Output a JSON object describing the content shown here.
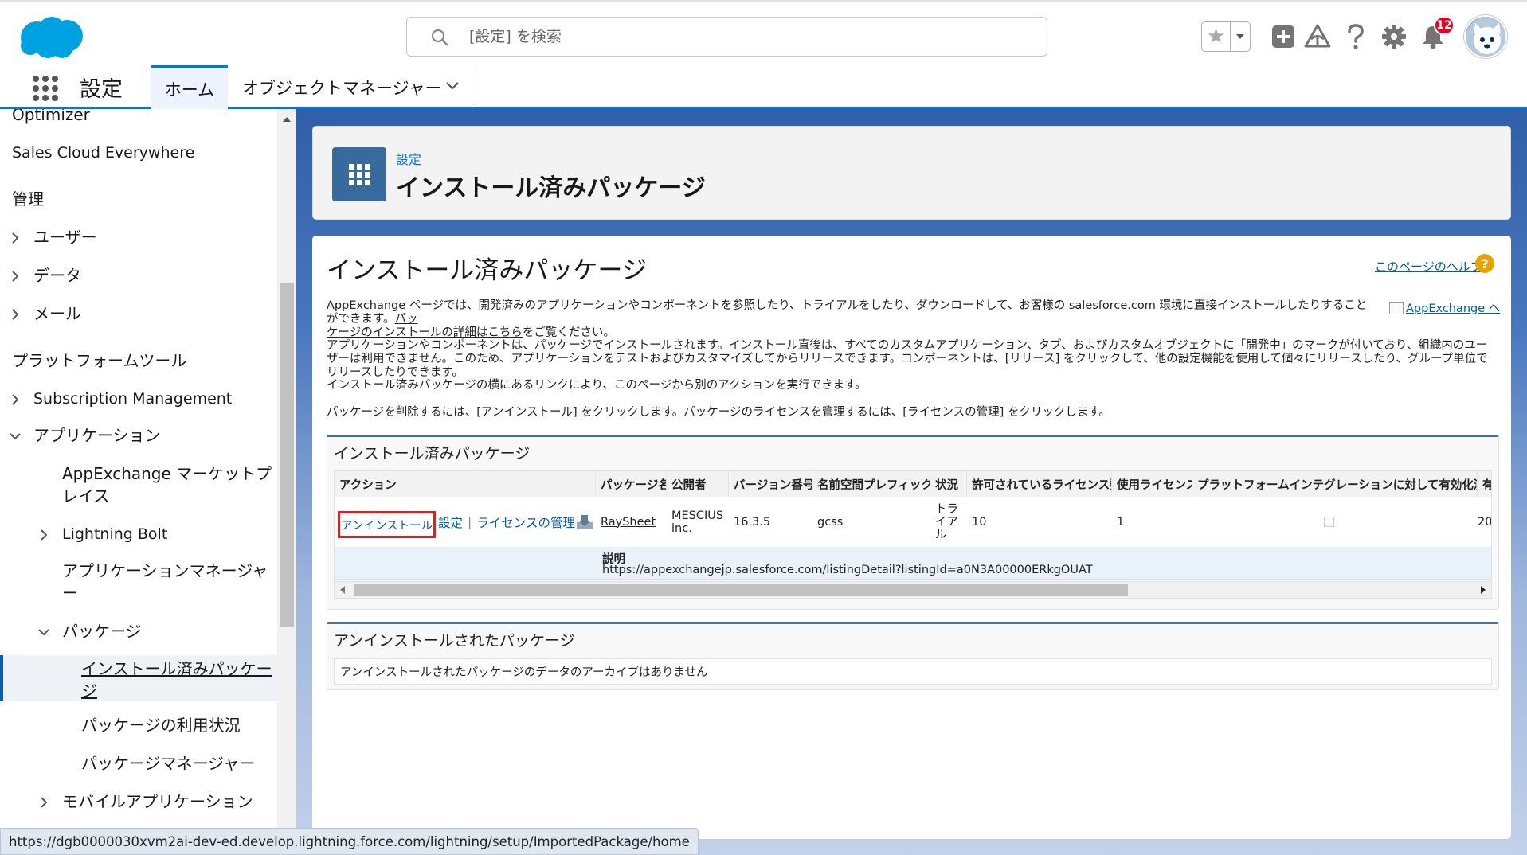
{
  "header": {
    "search_placeholder": "[設定] を検索",
    "notifications_count": "12",
    "accent_color": "#0176d3",
    "icons": [
      "salesforce-cloud-icon",
      "search-icon",
      "star-icon",
      "add-icon",
      "trailhead-icon",
      "help-icon",
      "gear-icon",
      "bell-icon",
      "avatar"
    ]
  },
  "context": {
    "app_name": "設定",
    "tabs": [
      {
        "label": "ホーム",
        "active": true
      },
      {
        "label": "オブジェクトマネージャー",
        "active": false
      }
    ]
  },
  "sidebar": {
    "items": [
      {
        "label": "Optimizer"
      },
      {
        "label": "Sales Cloud Everywhere"
      },
      {
        "label": "管理"
      },
      {
        "label": "ユーザー",
        "expandable": true
      },
      {
        "label": "データ",
        "expandable": true
      },
      {
        "label": "メール",
        "expandable": true
      },
      {
        "label": "プラットフォームツール"
      },
      {
        "label": "Subscription Management",
        "expandable": true
      },
      {
        "label": "アプリケーション",
        "expanded": true
      },
      {
        "label": "AppExchange マーケットプレイス"
      },
      {
        "label": "Lightning Bolt",
        "expandable": true
      },
      {
        "label": "アプリケーションマネージャー"
      },
      {
        "label": "パッケージ",
        "expanded": true
      },
      {
        "label": "インストール済みパッケージ",
        "selected": true
      },
      {
        "label": "パッケージの利用状況"
      },
      {
        "label": "パッケージマネージャー"
      },
      {
        "label": "モバイルアプリケーション",
        "expandable": true
      }
    ]
  },
  "page_header": {
    "breadcrumb": "設定",
    "title": "インストール済みパッケージ"
  },
  "main": {
    "title": "インストール済みパッケージ",
    "help_link": "このページのヘルプ",
    "appexchange_img_alt": "AppExchange へ",
    "para1_line1": "AppExchange ページでは、開発済みのアプリケーションやコンポーネントを参照したり、トライアルをしたり、ダウンロードして、お客様の salesforce.com 環境に直接インストールしたりすることができます。",
    "para1_link_a": "パッ",
    "para1_link_b": "ケージのインストールの詳細はこちら",
    "para1_tail": "をご覧ください。",
    "para2": "アプリケーションやコンポーネントは、パッケージでインストールされます。インストール直後は、すべてのカスタムアプリケーション、タブ、およびカスタムオブジェクトに「開発中」のマークが付いており、組織内のユーザーは利用できません。このため、アプリケーションをテストおよびカスタマイズしてからリリースできます。コンポーネントは、[リリース] をクリックして、他の設定機能を使用して個々にリリースしたり、グループ単位でリリースしたりできます。",
    "para3": "インストール済みパッケージの横にあるリンクにより、このページから別のアクションを実行できます。",
    "para4": "パッケージを削除するには、[アンインストール] をクリックします。パッケージのライセンスを管理するには、[ライセンスの管理] をクリックします。"
  },
  "installed": {
    "section_title": "インストール済みパッケージ",
    "columns": [
      "アクション",
      "パッケージ名",
      "公開者",
      "バージョン番号",
      "名前空間プレフィックス",
      "状況",
      "許可されているライセンス数",
      "使用ライセンス",
      "プラットフォームインテグレーションに対して有効化済み",
      "有"
    ],
    "row": {
      "uninstall": "アンインストール",
      "settings": "設定",
      "separator": "|",
      "manage_licenses": "ライセンスの管理",
      "package_name": "RaySheet",
      "publisher_line1": "MESCIUS",
      "publisher_line2": "inc.",
      "version": "16.3.5",
      "namespace": "gcss",
      "status_lines": [
        "トラ",
        "イア",
        "ル"
      ],
      "allowed_licenses": "10",
      "used_licenses": "1",
      "last_col": "20"
    },
    "description_label": "説明",
    "description_value": "https://appexchangejp.salesforce.com/listingDetail?listingId=a0N3A00000ERkgOUAT"
  },
  "uninstalled": {
    "section_title": "アンインストールされたパッケージ",
    "empty_message": "アンインストールされたパッケージのデータのアーカイブはありません"
  },
  "status_bar": {
    "url": "https://dgb0000030xvm2ai-dev-ed.develop.lightning.force.com/lightning/setup/ImportedPackage/home"
  }
}
